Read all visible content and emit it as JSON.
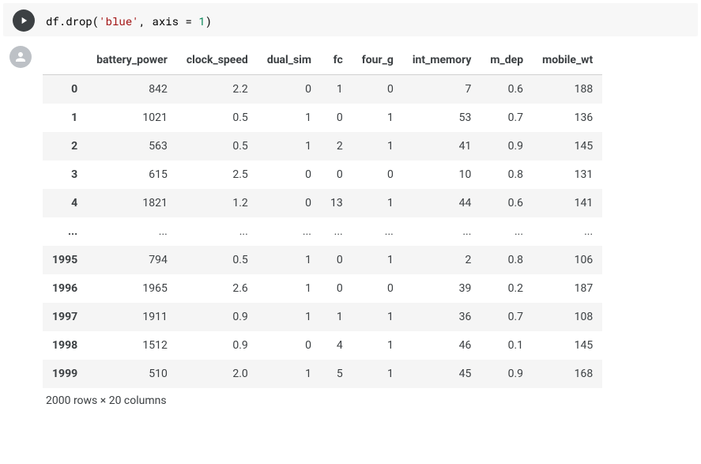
{
  "code": {
    "line_prefix": "df.drop(",
    "string_arg": "'blue'",
    "mid": ", axis = ",
    "num": "1",
    "suffix": ")"
  },
  "table": {
    "index_name": "",
    "columns": [
      "battery_power",
      "clock_speed",
      "dual_sim",
      "fc",
      "four_g",
      "int_memory",
      "m_dep",
      "mobile_wt"
    ],
    "rows": [
      {
        "idx": "0",
        "cells": [
          "842",
          "2.2",
          "0",
          "1",
          "0",
          "7",
          "0.6",
          "188"
        ]
      },
      {
        "idx": "1",
        "cells": [
          "1021",
          "0.5",
          "1",
          "0",
          "1",
          "53",
          "0.7",
          "136"
        ]
      },
      {
        "idx": "2",
        "cells": [
          "563",
          "0.5",
          "1",
          "2",
          "1",
          "41",
          "0.9",
          "145"
        ]
      },
      {
        "idx": "3",
        "cells": [
          "615",
          "2.5",
          "0",
          "0",
          "0",
          "10",
          "0.8",
          "131"
        ]
      },
      {
        "idx": "4",
        "cells": [
          "1821",
          "1.2",
          "0",
          "13",
          "1",
          "44",
          "0.6",
          "141"
        ]
      },
      {
        "idx": "...",
        "cells": [
          "...",
          "...",
          "...",
          "...",
          "...",
          "...",
          "...",
          "..."
        ]
      },
      {
        "idx": "1995",
        "cells": [
          "794",
          "0.5",
          "1",
          "0",
          "1",
          "2",
          "0.8",
          "106"
        ]
      },
      {
        "idx": "1996",
        "cells": [
          "1965",
          "2.6",
          "1",
          "0",
          "0",
          "39",
          "0.2",
          "187"
        ]
      },
      {
        "idx": "1997",
        "cells": [
          "1911",
          "0.9",
          "1",
          "1",
          "1",
          "36",
          "0.7",
          "108"
        ]
      },
      {
        "idx": "1998",
        "cells": [
          "1512",
          "0.9",
          "0",
          "4",
          "1",
          "46",
          "0.1",
          "145"
        ]
      },
      {
        "idx": "1999",
        "cells": [
          "510",
          "2.0",
          "1",
          "5",
          "1",
          "45",
          "0.9",
          "168"
        ]
      }
    ]
  },
  "shape_text": "2000 rows × 20 columns"
}
